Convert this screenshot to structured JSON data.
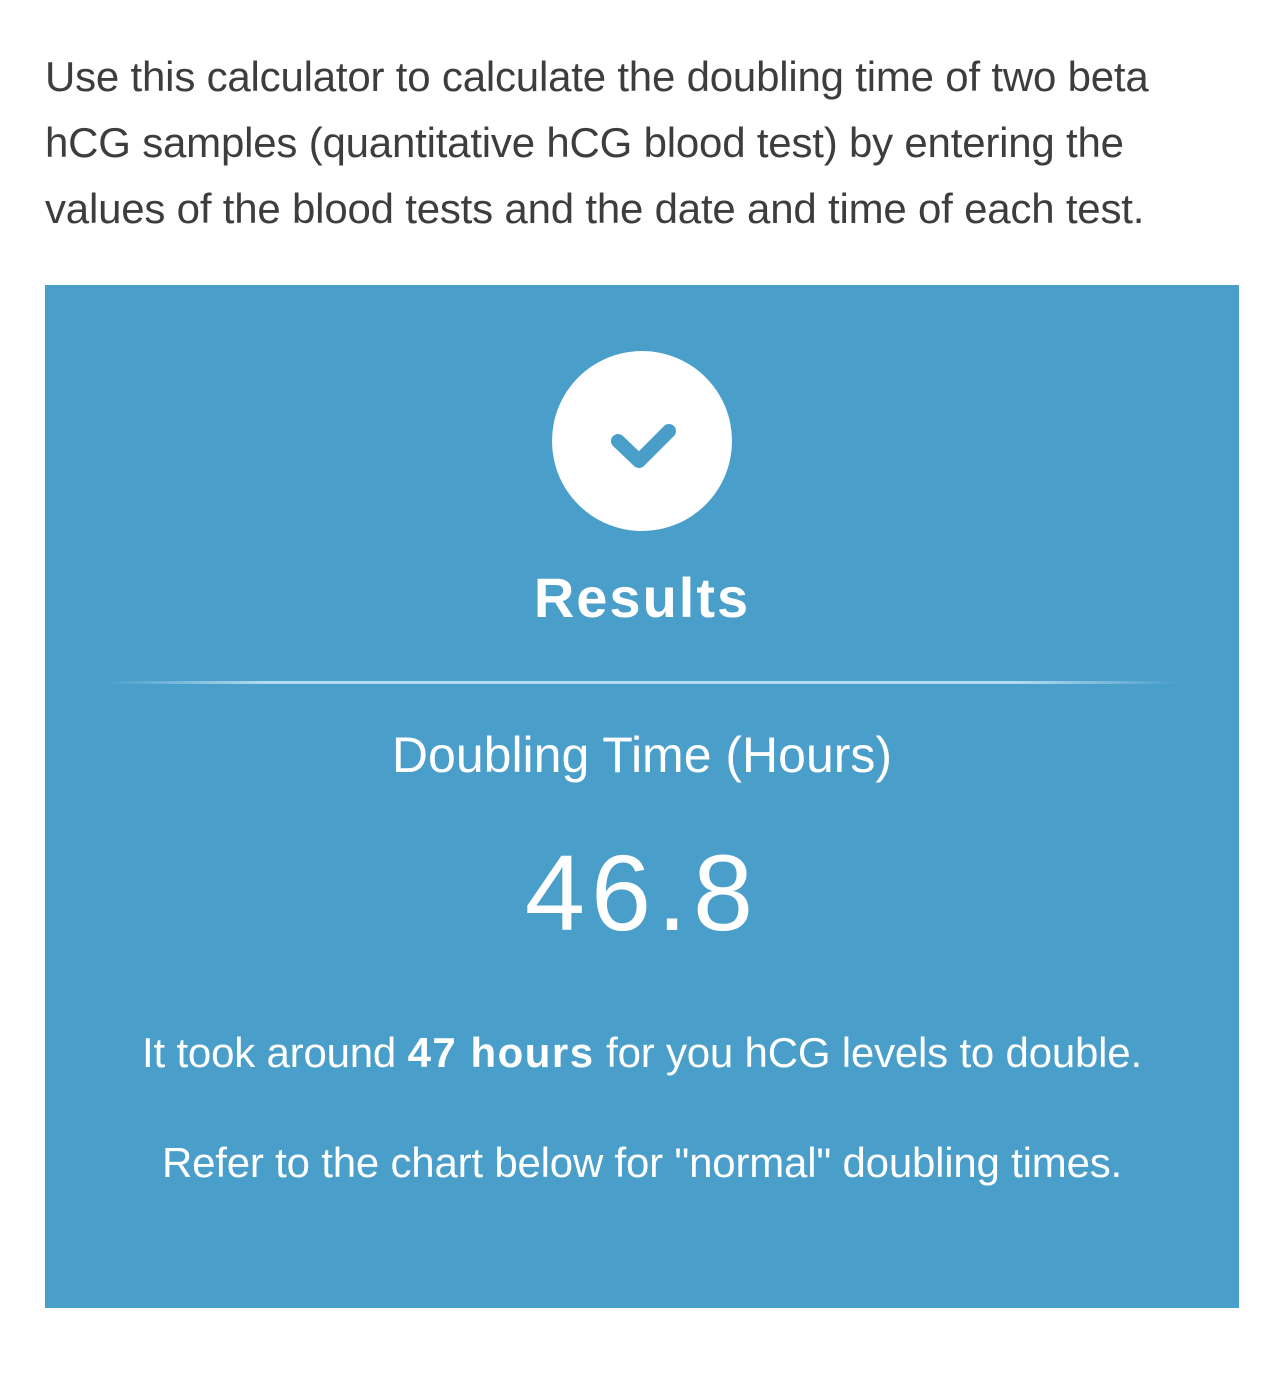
{
  "intro": {
    "text": "Use this calculator to calculate the doubling time of two beta hCG samples (quantitative hCG blood test) by entering the values of the blood tests and the date and time of each test."
  },
  "results": {
    "icon": "check-icon",
    "title": "Results",
    "metric_label": "Doubling Time (Hours)",
    "metric_value": "46.8",
    "summary_prefix": "It took around ",
    "summary_bold": "47 hours",
    "summary_suffix": " for you hCG levels to double.",
    "note": "Refer to the chart below for \"normal\" doubling times."
  },
  "colors": {
    "panel_background": "#4a9eca",
    "intro_text": "#3d3d3d",
    "results_text": "#ffffff"
  }
}
